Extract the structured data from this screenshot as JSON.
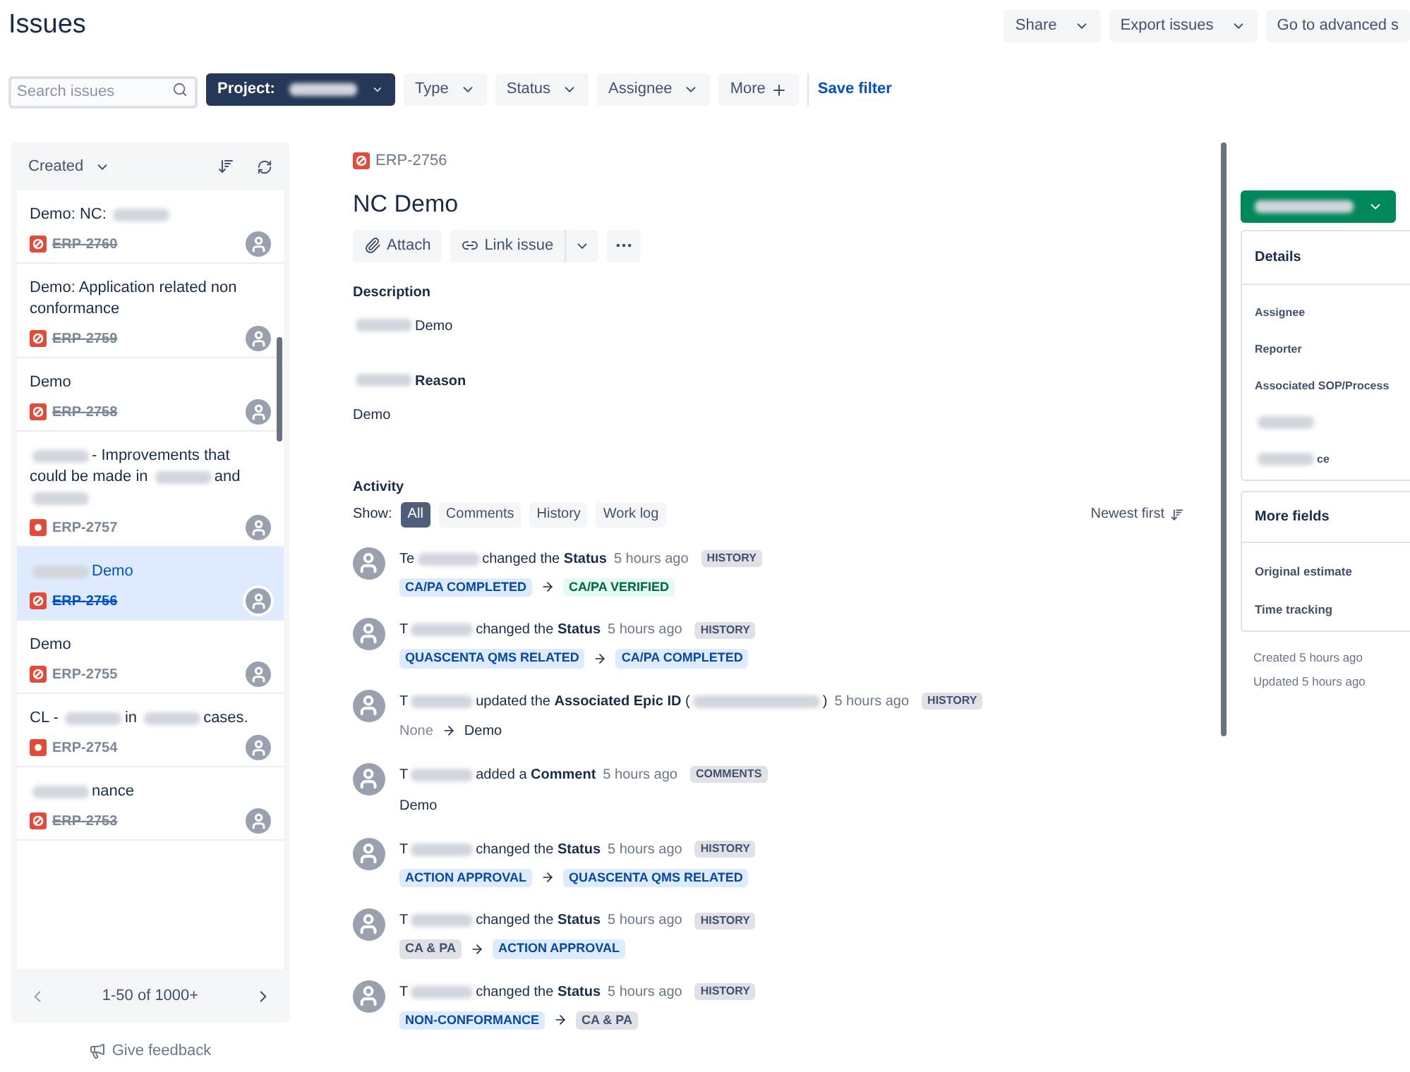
{
  "page_title": "Issues",
  "header_buttons": [
    {
      "label": "Share"
    },
    {
      "label": "Export issues"
    },
    {
      "label": "Go to advanced s"
    }
  ],
  "filters": {
    "search": {
      "placeholder": "Search issues"
    },
    "project_label": "Project:",
    "dropdowns": [
      "Type",
      "Status",
      "Assignee"
    ],
    "more": "More",
    "save": "Save filter"
  },
  "list": {
    "sort": "Created",
    "pagination": "1-50 of 1000+",
    "items": [
      {
        "parts": [
          {
            "kind": "text",
            "text": "Demo: NC:"
          },
          {
            "kind": "blur"
          }
        ],
        "key": "ERP-2760",
        "kind": "blocked",
        "resolved": true,
        "selected": false
      },
      {
        "parts": [
          {
            "kind": "text",
            "text": "Demo: Application related non conformance"
          }
        ],
        "key": "ERP-2759",
        "kind": "blocked",
        "resolved": true,
        "selected": false
      },
      {
        "parts": [
          {
            "kind": "text",
            "text": "Demo"
          }
        ],
        "key": "ERP-2758",
        "kind": "blocked",
        "resolved": true,
        "selected": false
      },
      {
        "parts": [
          {
            "kind": "blur"
          },
          {
            "kind": "text",
            "text": "- Improvements that could be made in"
          },
          {
            "kind": "blur"
          },
          {
            "kind": "text",
            "text": "and"
          },
          {
            "kind": "blur"
          }
        ],
        "key": "ERP-2757",
        "kind": "dot",
        "resolved": false,
        "selected": false
      },
      {
        "parts": [
          {
            "kind": "blur"
          },
          {
            "kind": "text",
            "text": "Demo"
          }
        ],
        "key": "ERP-2756",
        "kind": "blocked",
        "resolved": true,
        "selected": true
      },
      {
        "parts": [
          {
            "kind": "text",
            "text": "Demo"
          }
        ],
        "key": "ERP-2755",
        "kind": "blocked",
        "resolved": false,
        "selected": false
      },
      {
        "parts": [
          {
            "kind": "text",
            "text": "CL -"
          },
          {
            "kind": "blur"
          },
          {
            "kind": "text",
            "text": "in"
          },
          {
            "kind": "blur"
          },
          {
            "kind": "text",
            "text": "cases."
          }
        ],
        "key": "ERP-2754",
        "kind": "dot",
        "resolved": false,
        "selected": false
      },
      {
        "parts": [
          {
            "kind": "blur"
          },
          {
            "kind": "text",
            "text": "nance"
          }
        ],
        "key": "ERP-2753",
        "kind": "blocked",
        "resolved": true,
        "selected": false
      }
    ],
    "feedback": "Give feedback"
  },
  "issue": {
    "key": "ERP-2756",
    "title": "NC Demo",
    "actions": [
      "Attach",
      "Link issue"
    ],
    "sections": [
      {
        "heading_parts": [
          {
            "kind": "text",
            "text": "Description"
          }
        ],
        "body_parts": [
          {
            "kind": "blur"
          },
          {
            "kind": "text",
            "text": "Demo"
          }
        ]
      },
      {
        "heading_parts": [
          {
            "kind": "blur"
          },
          {
            "kind": "text",
            "text": "Reason"
          }
        ],
        "body_parts": [
          {
            "kind": "text",
            "text": "Demo"
          }
        ]
      }
    ],
    "activity": {
      "heading": "Activity",
      "show_label": "Show:",
      "tabs": [
        {
          "label": "All",
          "selected": true
        },
        {
          "label": "Comments",
          "selected": false
        },
        {
          "label": "History",
          "selected": false
        },
        {
          "label": "Work log",
          "selected": false
        }
      ],
      "order": "Newest first",
      "entries": [
        {
          "kind": "change",
          "actor": "Te",
          "verb": "changed the",
          "field": "Status",
          "time": "5 hours ago",
          "tag": "HISTORY",
          "from": {
            "text": "CA/PA COMPLETED",
            "color": "#deebff"
          },
          "to": {
            "text": "CA/PA VERIFIED",
            "color": "#e3fcef"
          }
        },
        {
          "kind": "change",
          "actor": "T",
          "verb": "changed the",
          "field": "Status",
          "time": "5 hours ago",
          "tag": "HISTORY",
          "from": {
            "text": "QUASCENTA QMS RELATED",
            "color": "#deebff"
          },
          "to": {
            "text": "CA/PA COMPLETED",
            "color": "#deebff"
          }
        },
        {
          "kind": "update",
          "actor": "T",
          "verb": "updated the",
          "field": "Associated Epic ID",
          "target_parts": [
            {
              "kind": "text",
              "text": "("
            },
            {
              "kind": "blur"
            },
            {
              "kind": "text",
              "text": ")"
            }
          ],
          "time": "5 hours ago",
          "tag": "HISTORY",
          "from": {
            "text": "None"
          },
          "to": {
            "text": "Demo"
          }
        },
        {
          "kind": "comment",
          "actor": "T",
          "verb": "added a",
          "field": "Comment",
          "time": "5 hours ago",
          "tag": "COMMENTS",
          "body": "Demo"
        },
        {
          "kind": "change",
          "actor": "T",
          "verb": "changed the",
          "field": "Status",
          "time": "5 hours ago",
          "tag": "HISTORY",
          "from": {
            "text": "ACTION APPROVAL",
            "color": "#deebff"
          },
          "to": {
            "text": "QUASCENTA QMS RELATED",
            "color": "#deebff"
          }
        },
        {
          "kind": "change",
          "actor": "T",
          "verb": "changed the",
          "field": "Status",
          "time": "5 hours ago",
          "tag": "HISTORY",
          "from": {
            "text": "CA & PA",
            "color": "#dfe1e6"
          },
          "to": {
            "text": "ACTION APPROVAL",
            "color": "#deebff"
          }
        },
        {
          "kind": "change",
          "actor": "T",
          "verb": "changed the",
          "field": "Status",
          "time": "5 hours ago",
          "tag": "HISTORY",
          "from": {
            "text": "NON-CONFORMANCE",
            "color": "#deebff"
          },
          "to": {
            "text": "CA & PA",
            "color": "#dfe1e6"
          }
        }
      ]
    }
  },
  "details": {
    "heading": "Details",
    "fields": [
      {
        "parts": [
          {
            "kind": "text",
            "text": "Assignee"
          }
        ]
      },
      {
        "parts": [
          {
            "kind": "text",
            "text": "Reporter"
          }
        ]
      },
      {
        "parts": [
          {
            "kind": "text",
            "text": "Associated SOP/Process"
          }
        ]
      },
      {
        "parts": [
          {
            "kind": "blur"
          }
        ]
      },
      {
        "parts": [
          {
            "kind": "blur"
          },
          {
            "kind": "text",
            "text": "ce"
          }
        ]
      }
    ],
    "more_heading": "More fields",
    "more_fields": [
      "Original estimate",
      "Time tracking"
    ],
    "created": "Created 5 hours ago",
    "updated": "Updated 5 hours ago"
  }
}
